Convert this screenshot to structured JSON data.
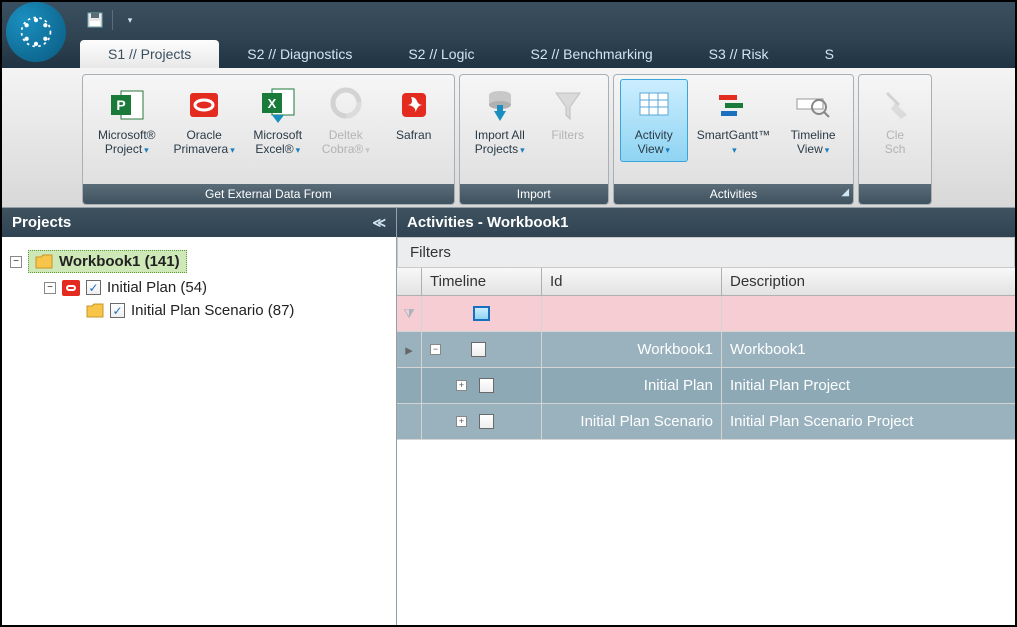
{
  "tabs": [
    {
      "label": "S1 // Projects",
      "active": true
    },
    {
      "label": "S2 // Diagnostics",
      "active": false
    },
    {
      "label": "S2 // Logic",
      "active": false
    },
    {
      "label": "S2 // Benchmarking",
      "active": false
    },
    {
      "label": "S3 // Risk",
      "active": false
    },
    {
      "label": "S",
      "active": false
    }
  ],
  "ribbon": {
    "group_external": {
      "label": "Get External Data From",
      "items": [
        {
          "label1": "Microsoft®",
          "label2": "Project",
          "dropdown": true
        },
        {
          "label1": "Oracle",
          "label2": "Primavera",
          "dropdown": true
        },
        {
          "label1": "Microsoft",
          "label2": "Excel®",
          "dropdown": true
        },
        {
          "label1": "Deltek",
          "label2": "Cobra®",
          "dropdown": true,
          "disabled": true
        },
        {
          "label1": "Safran",
          "label2": "",
          "dropdown": false
        }
      ]
    },
    "group_import": {
      "label": "Import",
      "items": [
        {
          "label1": "Import All",
          "label2": "Projects",
          "dropdown": true
        },
        {
          "label1": "Filters",
          "label2": "",
          "dropdown": false,
          "disabled": true
        }
      ]
    },
    "group_activities": {
      "label": "Activities",
      "items": [
        {
          "label1": "Activity",
          "label2": "View",
          "dropdown": true,
          "active": true
        },
        {
          "label1": "SmartGantt™",
          "label2": "",
          "dropdown": true
        },
        {
          "label1": "Timeline",
          "label2": "View",
          "dropdown": true
        }
      ]
    },
    "group_cut": {
      "items": [
        {
          "label1": "Cle",
          "label2": "Sch"
        }
      ]
    }
  },
  "projects_panel": {
    "title": "Projects",
    "tree": [
      {
        "level": 0,
        "toggle": "-",
        "icon": "folder",
        "checked": null,
        "label": "Workbook1 (141)",
        "selected": true
      },
      {
        "level": 1,
        "toggle": "-",
        "icon": "oracle",
        "checked": true,
        "label": "Initial  Plan (54)"
      },
      {
        "level": 2,
        "toggle": null,
        "icon": "folder",
        "checked": true,
        "label": "Initial  Plan Scenario (87)"
      }
    ]
  },
  "activities_panel": {
    "title": "Activities - Workbook1",
    "filters_label": "Filters",
    "columns": {
      "timeline": "Timeline",
      "id": "Id",
      "desc": "Description"
    },
    "rows": [
      {
        "kind": "filter"
      },
      {
        "kind": "data",
        "indent": 0,
        "toggle": "-",
        "id": "Workbook1",
        "desc": "Workbook1",
        "marker": "▸"
      },
      {
        "kind": "data",
        "indent": 1,
        "toggle": "+",
        "id": "Initial  Plan",
        "desc": "Initial  Plan Project"
      },
      {
        "kind": "data",
        "indent": 1,
        "toggle": "+",
        "id": "Initial  Plan Scenario",
        "desc": "Initial  Plan Scenario Project"
      }
    ]
  }
}
